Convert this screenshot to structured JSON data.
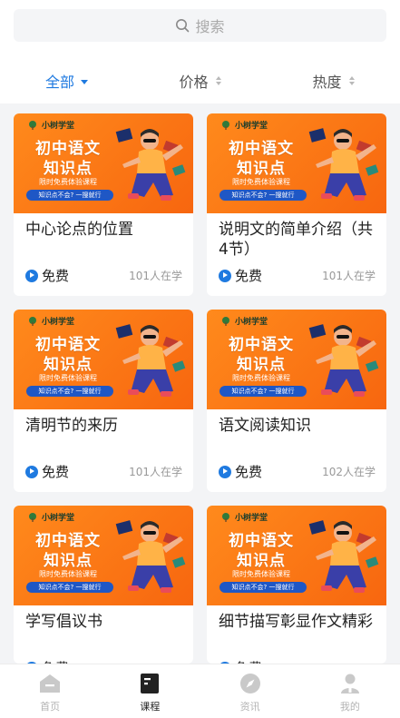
{
  "search": {
    "placeholder": "搜索"
  },
  "filters": [
    {
      "label": "全部",
      "active": true
    },
    {
      "label": "价格",
      "active": false
    },
    {
      "label": "热度",
      "active": false
    }
  ],
  "thumbnail": {
    "brand": "小树学堂",
    "title_line1": "初中语文",
    "title_line2": "知识点",
    "subtitle": "限时免费体验课程",
    "cta": "知识点不会? 一搜就行"
  },
  "courses": [
    {
      "title": "中心论点的位置",
      "price": "免费",
      "learners": "101人在学"
    },
    {
      "title": "说明文的简单介绍（共4节）",
      "price": "免费",
      "learners": "101人在学"
    },
    {
      "title": "清明节的来历",
      "price": "免费",
      "learners": "101人在学"
    },
    {
      "title": "语文阅读知识",
      "price": "免费",
      "learners": "102人在学"
    },
    {
      "title": "学写倡议书",
      "price": "免费",
      "learners": ""
    },
    {
      "title": "细节描写彰显作文精彩",
      "price": "免费",
      "learners": ""
    }
  ],
  "tabbar": [
    {
      "label": "首页",
      "icon": "home-icon",
      "active": false
    },
    {
      "label": "课程",
      "icon": "course-icon",
      "active": true
    },
    {
      "label": "资讯",
      "icon": "compass-icon",
      "active": false
    },
    {
      "label": "我的",
      "icon": "user-icon",
      "active": false
    }
  ],
  "colors": {
    "accent": "#1f7ae0",
    "thumb_orange": "#f7660f"
  }
}
